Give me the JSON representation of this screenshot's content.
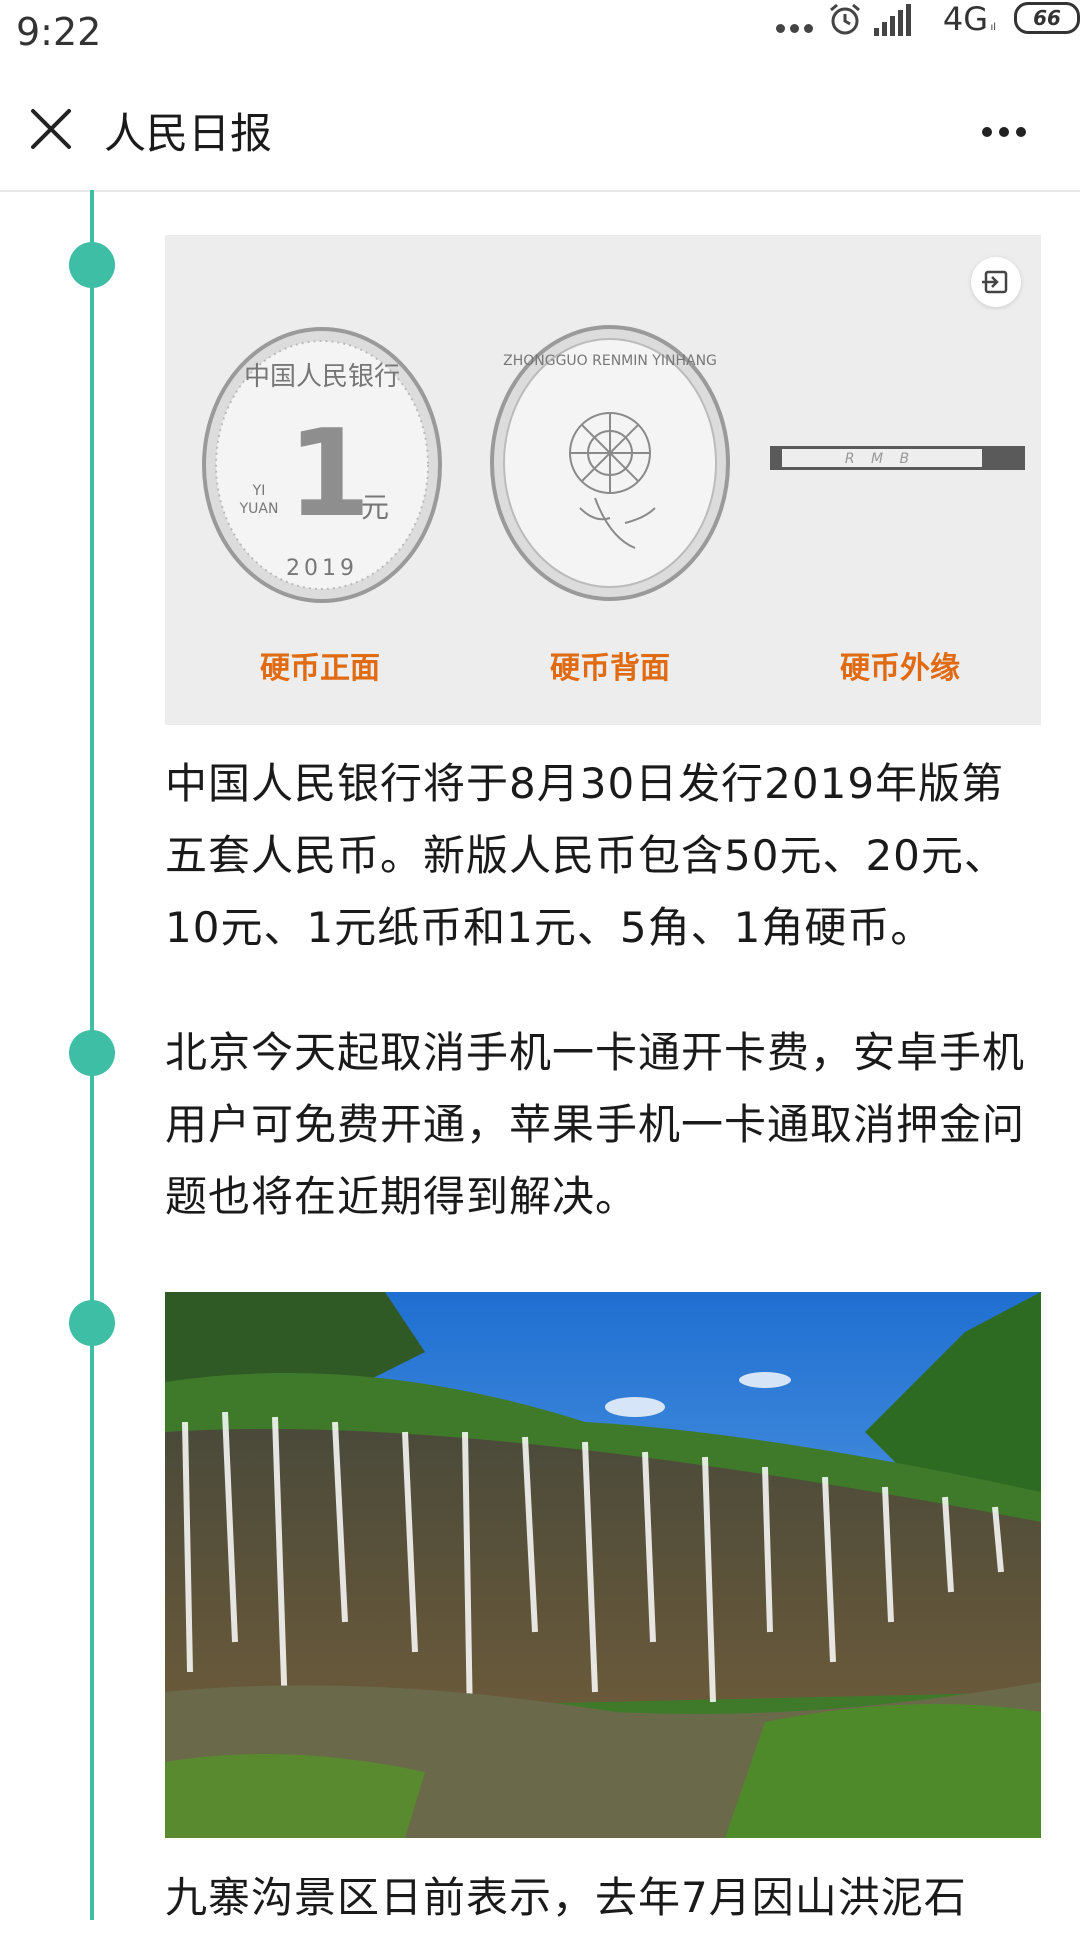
{
  "status_bar": {
    "time": "9:22",
    "network": "4G",
    "network_sub": "ıl",
    "battery": "66",
    "icons": [
      "more-dots-icon",
      "alarm-icon",
      "signal-icon",
      "battery-icon"
    ]
  },
  "nav": {
    "title": "人民日报",
    "close_icon": "close-icon",
    "more_icon": "more-options-icon"
  },
  "colors": {
    "timeline": "#3ebea4",
    "caption": "#e06b12",
    "text": "#1a1a1a"
  },
  "feed": {
    "items": [
      {
        "image": {
          "captions": [
            "硬币正面",
            "硬币背面",
            "硬币外缘"
          ],
          "coin_front_top": "中国人民银行",
          "coin_front_value": "1",
          "coin_front_unit": "元",
          "coin_front_pinyin_1": "YI",
          "coin_front_pinyin_2": "YUAN",
          "coin_front_year": "2019",
          "coin_back_text": "ZHONGGUO RENMIN YINHANG",
          "coin_edge_text": "R M B"
        },
        "text": "中国人民银行将于8月30日发行2019年版第五套人民币。新版人民币包含50元、20元、10元、1元纸币和1元、5角、1角硬币。"
      },
      {
        "text": "北京今天起取消手机一卡通开卡费，安卓手机用户可免费开通，苹果手机一卡通取消押金问题也将在近期得到解决。"
      },
      {
        "image": "waterfall-landscape-photo",
        "text": "九寨沟景区日前表示，去年7月因山洪泥石"
      }
    ]
  }
}
